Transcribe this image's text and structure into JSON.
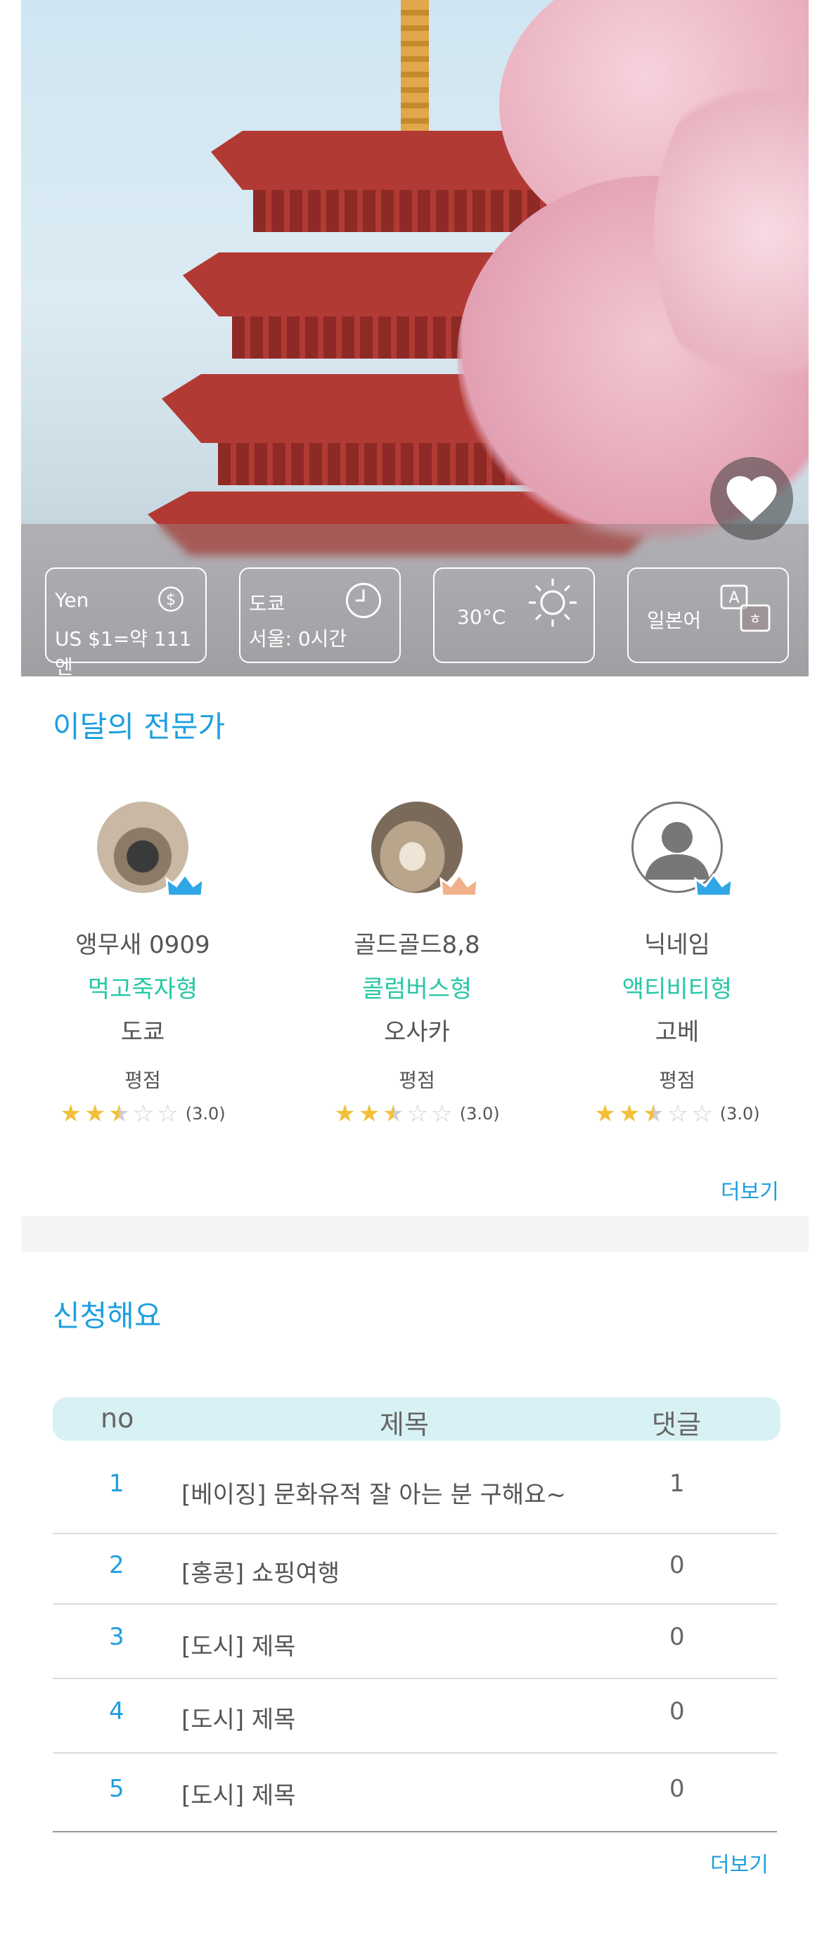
{
  "hero": {
    "favorite_icon": "heart-icon",
    "currency": {
      "label": "Yen",
      "rate": "US $1=약 111엔",
      "icon": "dollar-icon"
    },
    "time": {
      "city": "도쿄",
      "diff": "서울: 0시간",
      "icon": "clock-icon"
    },
    "weather": {
      "temp": "30°C",
      "icon": "sun-icon"
    },
    "language": {
      "label": "일본어",
      "icon": "translate-icon"
    }
  },
  "experts": {
    "title": "이달의 전문가",
    "more": "더보기",
    "items": [
      {
        "name": "앵무새 0909",
        "type": "먹고죽자형",
        "city": "도쿄",
        "rating_label": "평점",
        "rating": 2.5,
        "rating_text": "(3.0)",
        "crown_color": "#2fa6e6"
      },
      {
        "name": "골드골드8,8",
        "type": "콜럼버스형",
        "city": "오사카",
        "rating_label": "평점",
        "rating": 2.5,
        "rating_text": "(3.0)",
        "crown_color": "#f2b08a"
      },
      {
        "name": "닉네임",
        "type": "액티비티형",
        "city": "고베",
        "rating_label": "평점",
        "rating": 2.5,
        "rating_text": "(3.0)",
        "crown_color": "#2fa6e6"
      }
    ]
  },
  "requests": {
    "title": "신청해요",
    "more": "더보기",
    "columns": {
      "no": "no",
      "title": "제목",
      "comments": "댓글"
    },
    "rows": [
      {
        "no": "1",
        "title": "[베이징]  문화유적 잘 아는 분 구해요~",
        "comments": "1"
      },
      {
        "no": "2",
        "title": "[홍콩] 쇼핑여행",
        "comments": "0"
      },
      {
        "no": "3",
        "title": "[도시] 제목",
        "comments": "0"
      },
      {
        "no": "4",
        "title": "[도시] 제목",
        "comments": "0"
      },
      {
        "no": "5",
        "title": "[도시] 제목",
        "comments": "0"
      }
    ]
  },
  "colors": {
    "accent": "#1e9fe0",
    "type_green": "#27c7a6",
    "table_head": "#d8f1f5"
  }
}
